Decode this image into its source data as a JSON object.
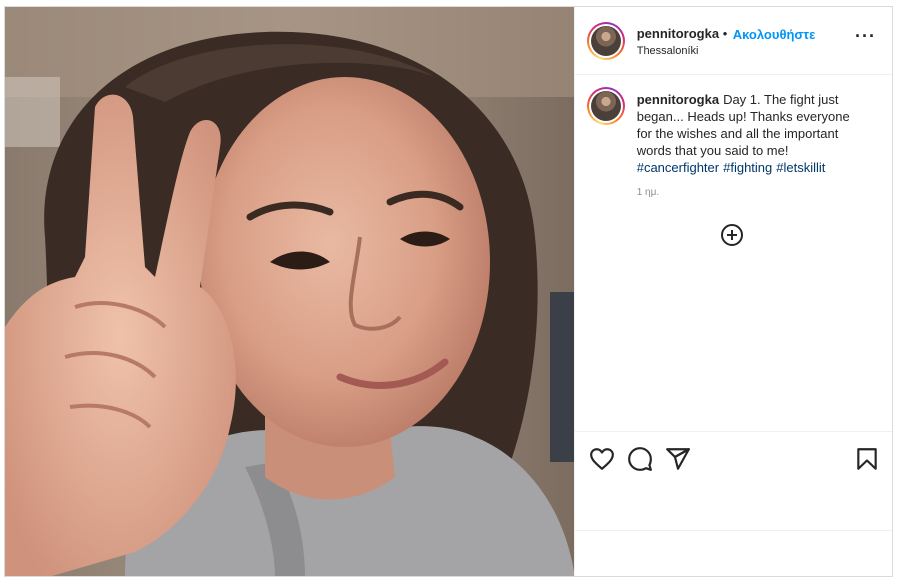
{
  "post": {
    "username": "pennitorogka",
    "follow_label": "Ακολουθήστε",
    "separator": "•",
    "location": "Thessaloníki",
    "more_icon": "more-options-icon",
    "caption": {
      "username": "pennitorogka",
      "text": "Day 1. The fight just began... Heads up! Thanks everyone for the wishes and all the important words that you said to me!",
      "hashtags": [
        "#cancerfighter",
        "#fighting",
        "#letskillit"
      ],
      "time": "1 ημ."
    },
    "icons": {
      "like": "heart-icon",
      "comment": "comment-icon",
      "share": "paper-plane-icon",
      "save": "bookmark-icon",
      "add_comment": "plus-circle-icon"
    },
    "colors": {
      "link_blue": "#0095f6",
      "hashtag": "#00376b",
      "text": "#262626",
      "muted": "#8e8e8e"
    }
  }
}
